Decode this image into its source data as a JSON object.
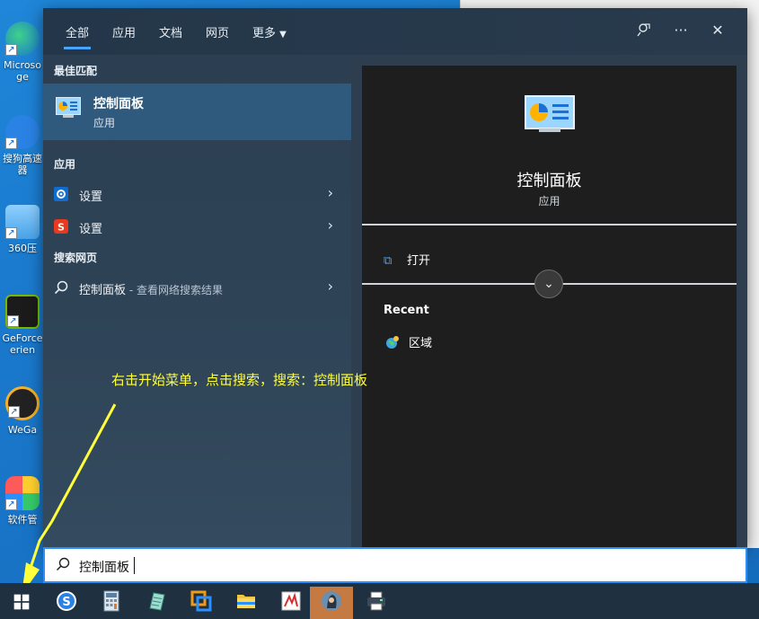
{
  "desktop": {
    "icons": [
      {
        "label": "Microso\nge"
      },
      {
        "label": "搜狗高速\n器"
      },
      {
        "label": "360压"
      },
      {
        "label": "GeForce\nerien"
      },
      {
        "label": "WeGa"
      },
      {
        "label": "软件管"
      }
    ]
  },
  "start_menu": {
    "tabs": [
      {
        "label": "全部"
      },
      {
        "label": "应用"
      },
      {
        "label": "文档"
      },
      {
        "label": "网页"
      },
      {
        "label": "更多"
      }
    ],
    "best_match_heading": "最佳匹配",
    "best_match": {
      "title": "控制面板",
      "subtitle": "应用"
    },
    "apps_heading": "应用",
    "apps": [
      {
        "label": "设置"
      },
      {
        "label": "设置"
      }
    ],
    "web_heading": "搜索网页",
    "web_result": {
      "label": "控制面板",
      "hint": " - 查看网络搜索结果"
    },
    "preview": {
      "title": "控制面板",
      "subtitle": "应用",
      "open_label": "打开",
      "recent_heading": "Recent",
      "recent_items": [
        {
          "label": "区域"
        }
      ]
    }
  },
  "annotation": {
    "text": "右击开始菜单，点击搜索，搜索：控制面板",
    "color": "#ffff3a"
  },
  "search": {
    "value": "控制面板"
  },
  "colors": {
    "accent": "#4aa3ff",
    "selected_row": "#2f5a7d"
  }
}
